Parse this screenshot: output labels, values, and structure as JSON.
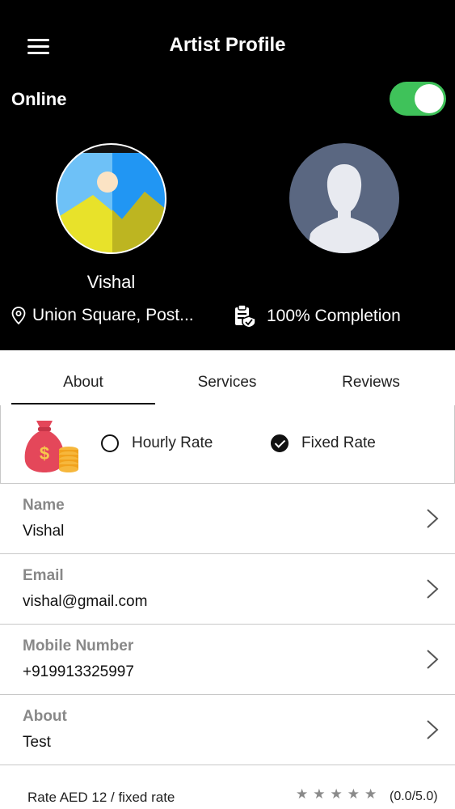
{
  "header": {
    "title": "Artist Profile",
    "menu_icon": "hamburger-menu-icon"
  },
  "status": {
    "label": "Online",
    "toggle_on": true,
    "accent": "#3fc25a"
  },
  "profile": {
    "name": "Vishal",
    "location": "Union Square, Post...",
    "completion": "100% Completion"
  },
  "tabs": {
    "items": [
      "About",
      "Services",
      "Reviews"
    ],
    "active": "About"
  },
  "rate_type": {
    "options": [
      {
        "label": "Hourly Rate",
        "checked": false
      },
      {
        "label": "Fixed Rate",
        "checked": true
      }
    ]
  },
  "fields": [
    {
      "label": "Name",
      "value": "Vishal"
    },
    {
      "label": "Email",
      "value": "vishal@gmail.com"
    },
    {
      "label": "Mobile Number",
      "value": "+919913325997"
    },
    {
      "label": "About",
      "value": "Test"
    }
  ],
  "footer": {
    "rate_text": "Rate AED 12 / fixed rate",
    "stars": "★★★★★",
    "score": "(0.0/5.0)"
  }
}
